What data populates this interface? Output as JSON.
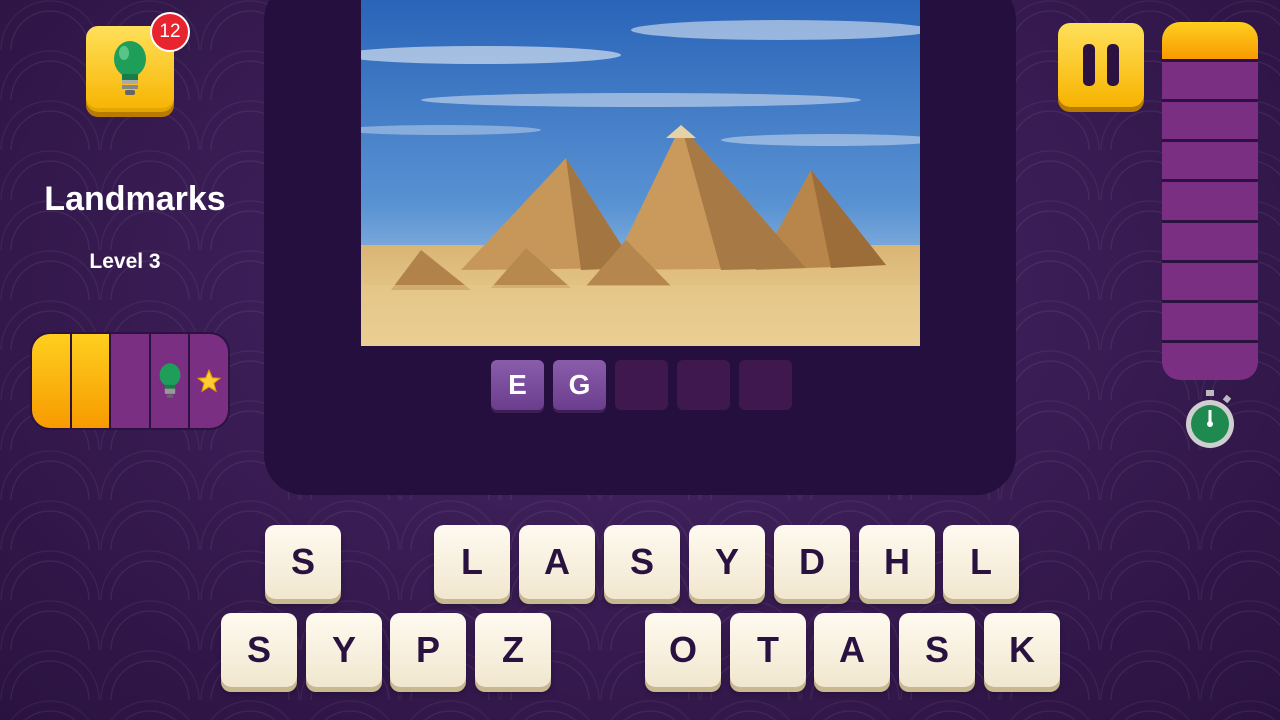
{
  "hint": {
    "count": "12",
    "icon": "lightbulb-icon"
  },
  "category": "Landmarks",
  "level": "Level 3",
  "level_progress": {
    "filled": 2,
    "total": 5,
    "icons": [
      "lightbulb-icon",
      "star-icon"
    ]
  },
  "photo": {
    "subject": "pyramids-photo"
  },
  "answer": {
    "slots": [
      "E",
      "G",
      "",
      "",
      ""
    ]
  },
  "timer": {
    "remaining_segments": 1,
    "total_segments": 9,
    "icon": "stopwatch-icon"
  },
  "keyboard": {
    "row1": [
      "S",
      "",
      "L",
      "A",
      "S",
      "Y",
      "D",
      "H",
      "L"
    ],
    "row2": [
      "S",
      "Y",
      "P",
      "Z",
      "",
      "O",
      "T",
      "A",
      "S",
      "K"
    ]
  },
  "colors": {
    "accent": "#f7b300",
    "background": "#3a1d55",
    "card": "#250f3e"
  }
}
